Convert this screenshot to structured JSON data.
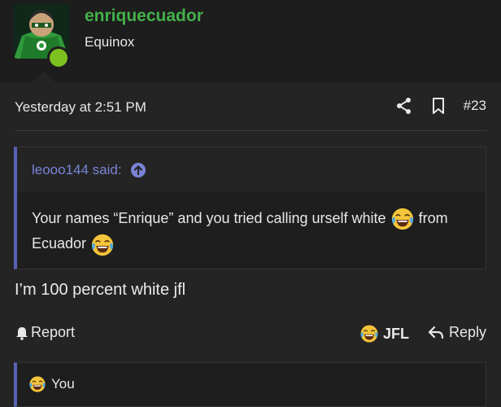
{
  "header": {
    "username": "enriquecuador",
    "user_title": "Equinox",
    "avatar_icon": "green-lantern-avatar",
    "online_color": "#7cc11f",
    "username_color": "#43b04a"
  },
  "post": {
    "timestamp": "Yesterday at 2:51 PM",
    "post_number": "#23",
    "share_icon": "share-icon",
    "bookmark_icon": "bookmark-icon",
    "quote": {
      "author_label": "leooo144 said:",
      "author_color": "#7a84d6",
      "line1_text": "Your names “Enrique” and you tried calling urself white",
      "line1_after": "from",
      "line2_text": "Ecuador",
      "emoji_icon": "tears-of-joy-emoji"
    },
    "body": "I’m 100 percent white jfl",
    "actions": {
      "report_label": "Report",
      "reaction_label": "JFL",
      "reply_label": "Reply"
    },
    "reactions_bar": {
      "label": "You"
    },
    "accent_color": "#5a62b8"
  }
}
